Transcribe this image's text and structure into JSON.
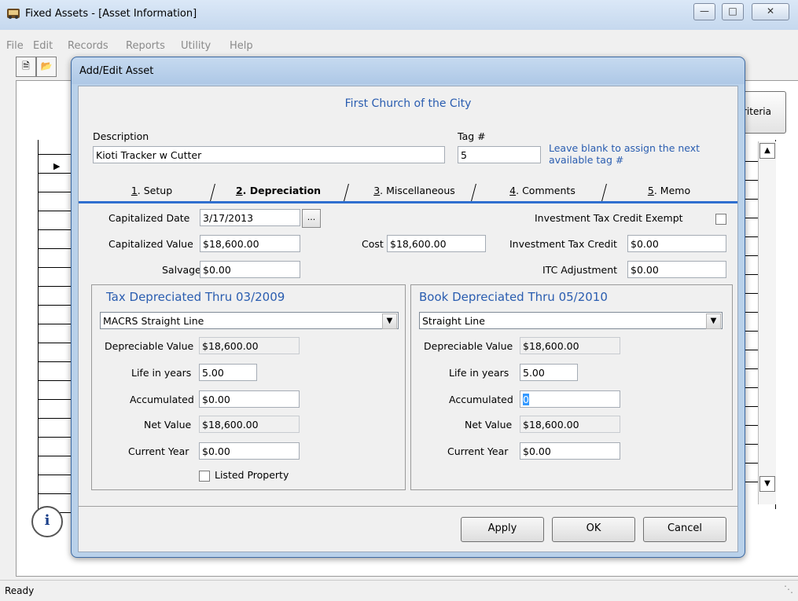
{
  "main_window": {
    "title": "Fixed Assets - [Asset Information]",
    "menu": [
      "File",
      "Edit",
      "Records",
      "Reports",
      "Utility",
      "Help"
    ],
    "criteria_button_label": "riteria",
    "status": "Ready"
  },
  "dialog": {
    "title": "Add/Edit Asset",
    "org_name": "First Church of the City",
    "description_label": "Description",
    "description_value": "Kioti Tracker w Cutter",
    "tag_label": "Tag #",
    "tag_value": "5",
    "tag_hint": "Leave blank to assign the next available tag #",
    "tabs": [
      {
        "key": "1",
        "label": "Setup"
      },
      {
        "key": "2",
        "label": "Depreciation"
      },
      {
        "key": "3",
        "label": "Miscellaneous"
      },
      {
        "key": "4",
        "label": "Comments"
      },
      {
        "key": "5",
        "label": "Memo"
      }
    ],
    "active_tab": "Depreciation",
    "capitalized_date_label": "Capitalized Date",
    "capitalized_date": "3/17/2013",
    "date_picker_button": "...",
    "capitalized_value_label": "Capitalized Value",
    "capitalized_value": "$18,600.00",
    "cost_label": "Cost",
    "cost_value": "$18,600.00",
    "salvage_label": "Salvage",
    "salvage_value": "$0.00",
    "itc_exempt_label": "Investment Tax Credit Exempt",
    "itc_label": "Investment Tax Credit",
    "itc_value": "$0.00",
    "itc_adjust_label": "ITC Adjustment",
    "itc_adjust_value": "$0.00",
    "tax": {
      "title": "Tax Depreciated Thru 03/2009",
      "method": "MACRS Straight Line",
      "depreciable_label": "Depreciable Value",
      "depreciable_value": "$18,600.00",
      "life_label": "Life in years",
      "life_value": "5.00",
      "accumulated_label": "Accumulated",
      "accumulated_value": "$0.00",
      "net_label": "Net Value",
      "net_value": "$18,600.00",
      "current_label": "Current Year",
      "current_value": "$0.00",
      "listed_property_label": "Listed Property"
    },
    "book": {
      "title": "Book Depreciated Thru 05/2010",
      "method": "Straight Line",
      "depreciable_label": "Depreciable Value",
      "depreciable_value": "$18,600.00",
      "life_label": "Life in years",
      "life_value": "5.00",
      "accumulated_label": "Accumulated",
      "accumulated_value": "0",
      "net_label": "Net Value",
      "net_value": "$18,600.00",
      "current_label": "Current Year",
      "current_value": "$0.00"
    },
    "buttons": {
      "apply": "Apply",
      "ok": "OK",
      "cancel": "Cancel"
    }
  }
}
